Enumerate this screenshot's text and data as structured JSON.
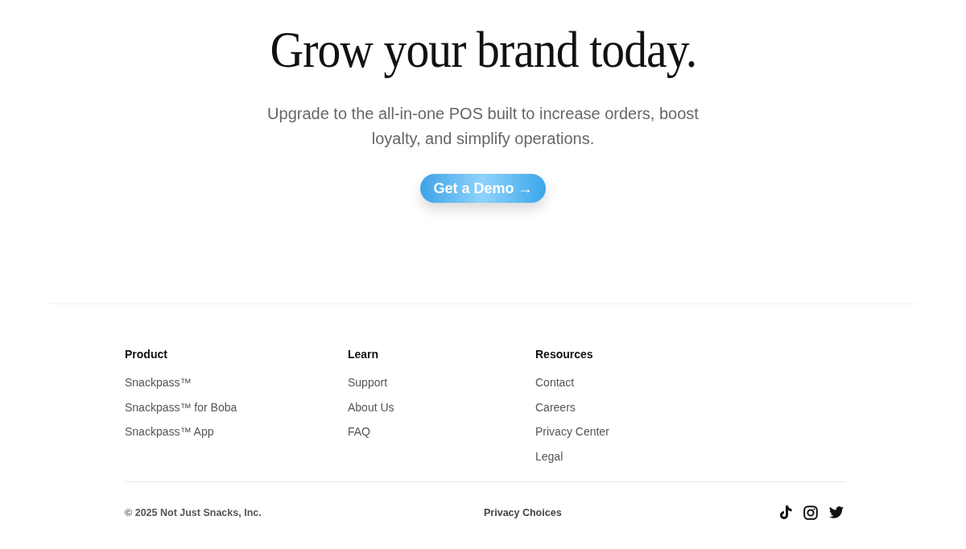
{
  "hero": {
    "title": "Grow your brand today.",
    "subtitle": "Upgrade to the all-in-one POS built to increase orders, boost loyalty, and simplify operations.",
    "button": {
      "label": "Get a Demo",
      "arrow": "→"
    }
  },
  "footer": {
    "columns": [
      {
        "heading": "Product",
        "links": [
          "Snackpass™",
          "Snackpass™ for Boba",
          "Snackpass™ App"
        ]
      },
      {
        "heading": "Learn",
        "links": [
          "Support",
          "About Us",
          "FAQ"
        ]
      },
      {
        "heading": "Resources",
        "links": [
          "Contact",
          "Careers",
          "Privacy Center",
          "Legal"
        ]
      }
    ],
    "copyright": "© 2025 Not Just Snacks, Inc.",
    "privacy_link": "Privacy Choices"
  }
}
